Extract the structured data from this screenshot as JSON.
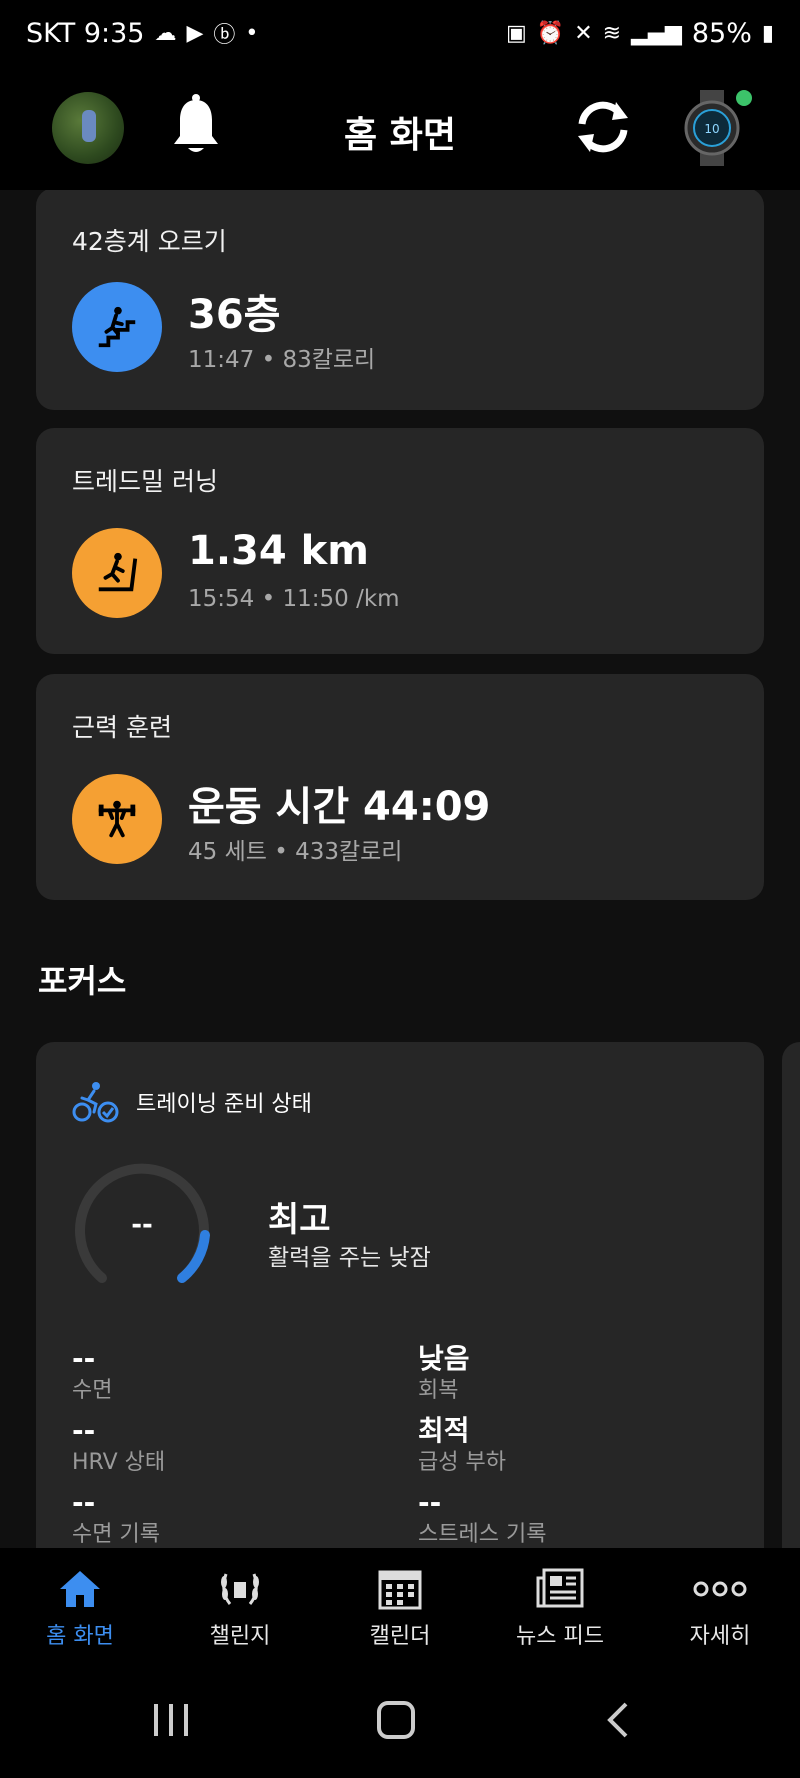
{
  "status": {
    "carrier_time": "SKT 9:35",
    "battery": "85%"
  },
  "header": {
    "title": "홈 화면"
  },
  "activities": [
    {
      "title": "42층계 오르기",
      "main": "36층",
      "sub": "11:47 • 83칼로리",
      "color": "#3d8ef0",
      "icon": "stairs-icon"
    },
    {
      "title": "트레드밀 러닝",
      "main": "1.34 km",
      "sub": "15:54 • 11:50 /km",
      "color": "#f5a033",
      "icon": "treadmill-icon"
    },
    {
      "title": "근력 훈련",
      "main": "운동 시간 44:09",
      "sub": "45 세트 • 433칼로리",
      "color": "#f5a033",
      "icon": "strength-icon"
    }
  ],
  "focus": {
    "section_title": "포커스",
    "card_title": "트레이닝 준비 상태",
    "gauge_value": "--",
    "rating": "최고",
    "rating_sub": "활력을 주는 낮잠",
    "metrics": [
      {
        "value": "--",
        "label": "수면"
      },
      {
        "value": "낮음",
        "label": "회복"
      },
      {
        "value": "--",
        "label": "HRV 상태"
      },
      {
        "value": "최적",
        "label": "급성 부하"
      },
      {
        "value": "--",
        "label": "수면 기록"
      },
      {
        "value": "--",
        "label": "스트레스 기록"
      }
    ]
  },
  "nav": [
    {
      "label": "홈 화면",
      "icon": "home-icon",
      "active": true
    },
    {
      "label": "챌린지",
      "icon": "laurel-icon",
      "active": false
    },
    {
      "label": "캘린더",
      "icon": "calendar-icon",
      "active": false
    },
    {
      "label": "뉴스 피드",
      "icon": "newsfeed-icon",
      "active": false
    },
    {
      "label": "자세히",
      "icon": "more-icon",
      "active": false
    }
  ],
  "colors": {
    "accent": "#3d8ef0",
    "orange": "#f5a033",
    "card": "#262626"
  }
}
